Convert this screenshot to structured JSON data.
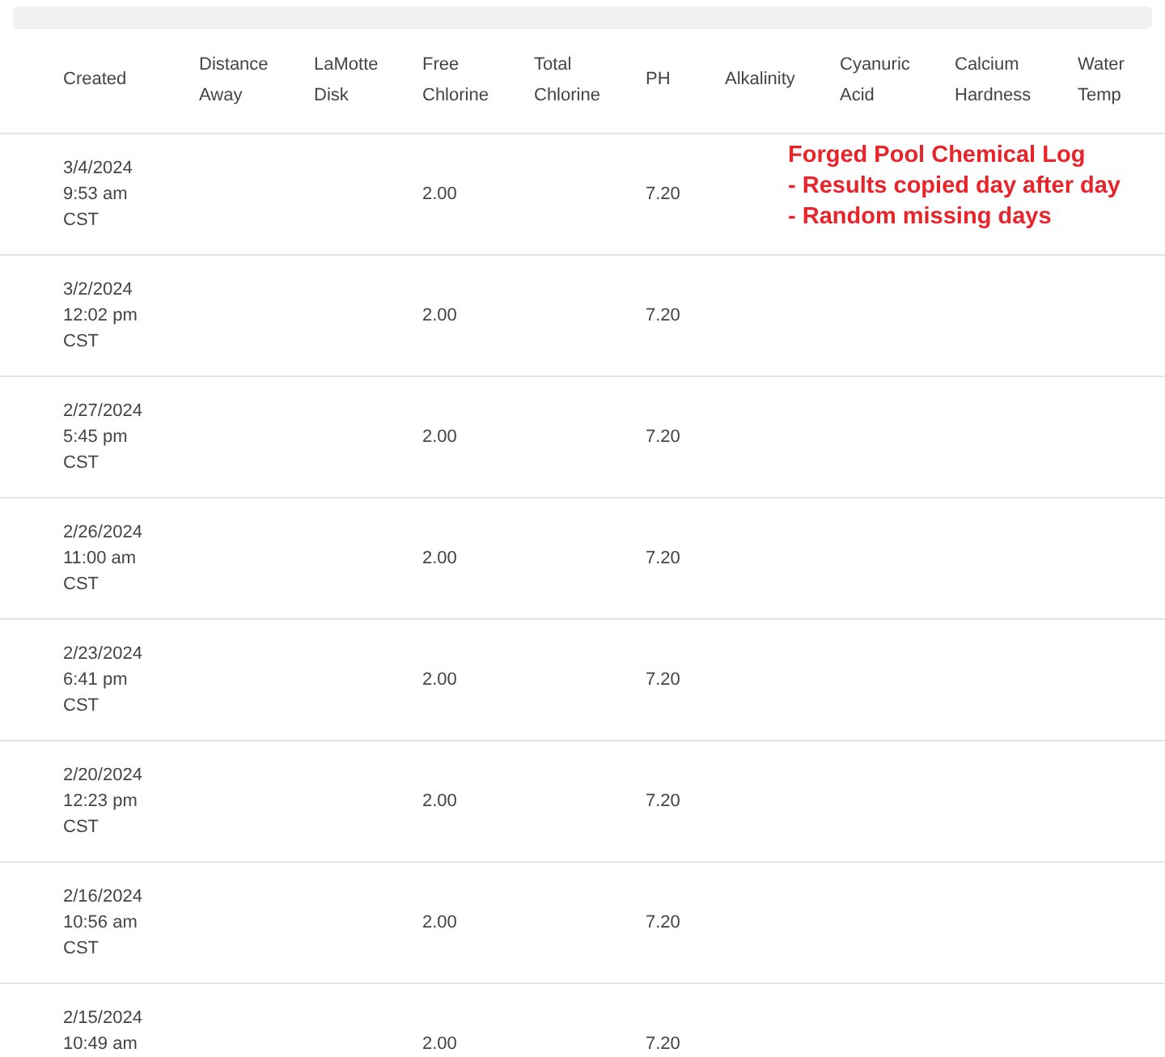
{
  "table": {
    "columns": [
      "Created",
      "Distance Away",
      "LaMotte Disk",
      "Free Chlorine",
      "Total Chlorine",
      "PH",
      "Alkalinity",
      "Cyanuric Acid",
      "Calcium Hardness",
      "Water Temp"
    ],
    "rows": [
      {
        "created": [
          "3/4/2024",
          "9:53 am",
          "CST"
        ],
        "free_chlorine": "2.00",
        "ph": "7.20"
      },
      {
        "created": [
          "3/2/2024",
          "12:02 pm",
          "CST"
        ],
        "free_chlorine": "2.00",
        "ph": "7.20"
      },
      {
        "created": [
          "2/27/2024",
          "5:45 pm",
          "CST"
        ],
        "free_chlorine": "2.00",
        "ph": "7.20"
      },
      {
        "created": [
          "2/26/2024",
          "11:00 am",
          "CST"
        ],
        "free_chlorine": "2.00",
        "ph": "7.20"
      },
      {
        "created": [
          "2/23/2024",
          "6:41 pm",
          "CST"
        ],
        "free_chlorine": "2.00",
        "ph": "7.20"
      },
      {
        "created": [
          "2/20/2024",
          "12:23 pm",
          "CST"
        ],
        "free_chlorine": "2.00",
        "ph": "7.20"
      },
      {
        "created": [
          "2/16/2024",
          "10:56 am",
          "CST"
        ],
        "free_chlorine": "2.00",
        "ph": "7.20"
      },
      {
        "created": [
          "2/15/2024",
          "10:49 am"
        ],
        "free_chlorine": "2.00",
        "ph": "7.20"
      }
    ]
  },
  "annotation": {
    "lines": [
      "Forged Pool Chemical Log",
      "- Results copied day after day",
      "- Random missing days"
    ]
  }
}
